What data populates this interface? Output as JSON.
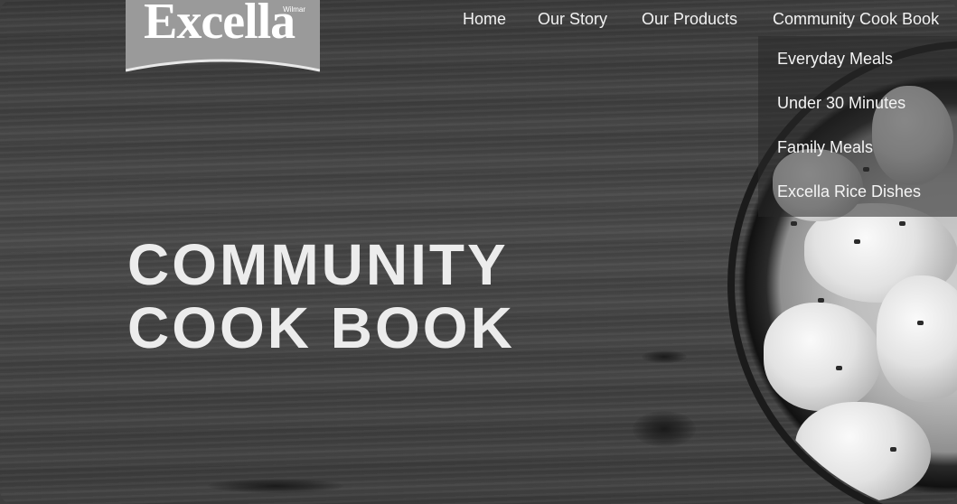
{
  "brand": {
    "logo_text": "Excella",
    "logo_tagline": "Wilmar"
  },
  "nav": {
    "items": [
      {
        "label": "Home"
      },
      {
        "label": "Our Story"
      },
      {
        "label": "Our Products"
      },
      {
        "label": "Community Cook Book"
      }
    ]
  },
  "dropdown": {
    "items": [
      {
        "label": "Everyday Meals"
      },
      {
        "label": "Under 30 Minutes"
      },
      {
        "label": "Family Meals"
      },
      {
        "label": "Excella Rice Dishes"
      }
    ]
  },
  "hero": {
    "headline_line1": "COMMUNITY",
    "headline_line2": "COOK BOOK"
  }
}
